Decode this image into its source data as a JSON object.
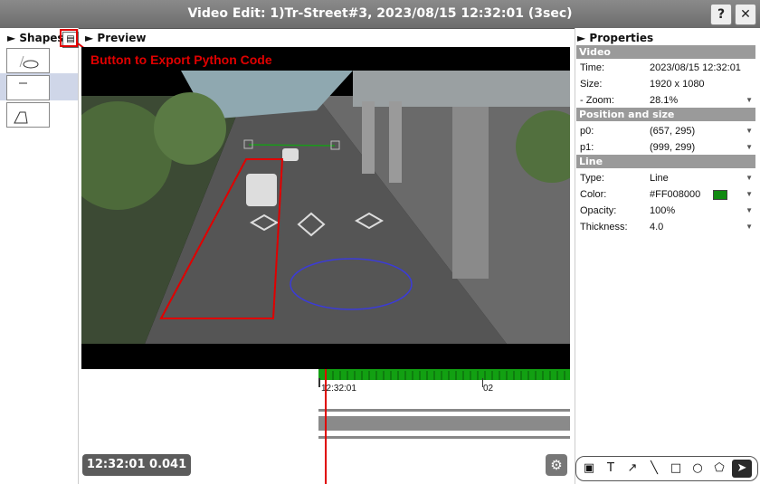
{
  "window": {
    "title": "Video Edit: 1)Tr-Street#3, 2023/08/15 12:32:01 (3sec)",
    "help_label": "?",
    "close_label": "✕"
  },
  "shapes_panel": {
    "header": "► Shapes",
    "items": [
      "ellipse",
      "line",
      "polygon"
    ],
    "selected_index": 1
  },
  "annotation": {
    "text": "Button to Export Python Code"
  },
  "preview": {
    "header": "► Preview",
    "timeline_start_label": "12:32:01",
    "timeline_mark_label": "02",
    "current_time": "12:32:01 0.041"
  },
  "properties": {
    "header": "► Properties",
    "sections": {
      "video": "Video",
      "position": "Position and size",
      "line": "Line"
    },
    "rows": {
      "time": {
        "label": "Time:",
        "value": "2023/08/15 12:32:01"
      },
      "size": {
        "label": "Size:",
        "value": "1920 x 1080"
      },
      "zoom": {
        "label": "- Zoom:",
        "value": "28.1%"
      },
      "p0": {
        "label": "p0:",
        "value": "(657, 295)"
      },
      "p1": {
        "label": "p1:",
        "value": "(999, 299)"
      },
      "type": {
        "label": "Type:",
        "value": "Line"
      },
      "color": {
        "label": "Color:",
        "value": "#FF008000"
      },
      "opacity": {
        "label": "Opacity:",
        "value": "100%"
      },
      "thickness": {
        "label": "Thickness:",
        "value": "4.0"
      }
    },
    "line_color": "#008000"
  },
  "toolbar": {
    "tools": [
      "image-tool",
      "text-tool",
      "arrow-tool",
      "line-tool",
      "rect-tool",
      "ellipse-tool",
      "polygon-tool",
      "select-tool"
    ],
    "active_tool": "select-tool"
  },
  "colors": {
    "annotation_red": "#e00000",
    "timeline_green": "#12a012",
    "ellipse_blue": "#3b3bd8"
  }
}
